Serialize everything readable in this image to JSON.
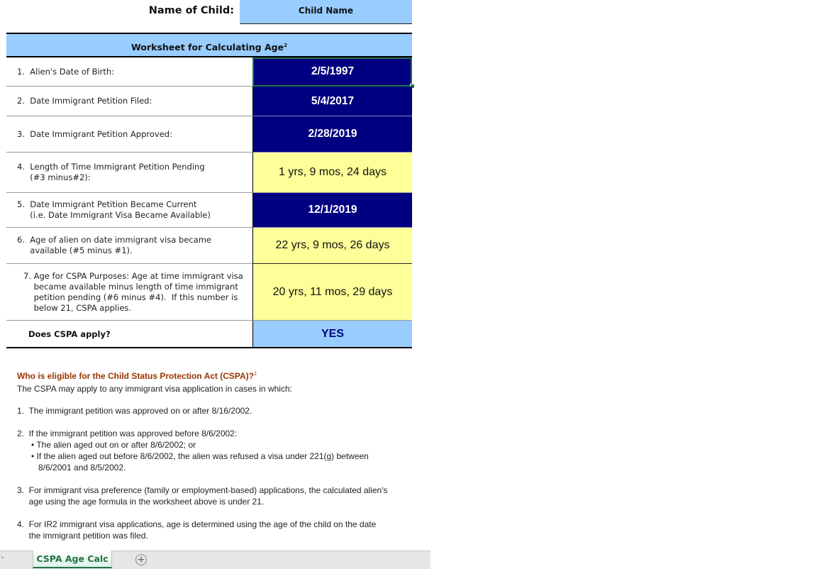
{
  "header": {
    "name_label": "Name of Child:",
    "name_value": "Child Name"
  },
  "worksheet": {
    "title": "Worksheet for Calculating Age",
    "title_footnote": "2",
    "rows": [
      {
        "label": "1.  Alien's Date of Birth:",
        "value": "2/5/1997",
        "style": "input"
      },
      {
        "label": "2.  Date Immigrant Petition Filed:",
        "value": "5/4/2017",
        "style": "input"
      },
      {
        "label": "3.  Date Immigrant Petition Approved:",
        "value": "2/28/2019",
        "style": "input"
      },
      {
        "label": "4.  Length of Time Immigrant Petition Pending\n     (#3 minus#2):",
        "value": "1 yrs, 9 mos, 24 days",
        "style": "calculated"
      },
      {
        "label": "5.  Date Immigrant Petition Became Current\n     (i.e. Date Immigrant Visa Became Available)",
        "value": "12/1/2019",
        "style": "input"
      },
      {
        "label": "6.  Age of alien on date immigrant visa became\n     available (#5 minus #1).",
        "value": "22 yrs, 9 mos, 26 days",
        "style": "calculated"
      },
      {
        "label": "7. Age for CSPA Purposes: Age at time immigrant visa\n    became available minus length of time immigrant\n    petition pending (#6 minus #4).  If this number is\n    below 21, CSPA applies.",
        "value": "20 yrs, 11 mos, 29 days",
        "style": "calculated"
      }
    ],
    "result_label": "Does CSPA apply?",
    "result_value": "YES"
  },
  "info": {
    "heading": "Who is eligible for the Child Status Protection Act (CSPA)?",
    "heading_footnote": "2",
    "intro": "The CSPA may apply to any immigrant visa application in cases in which:",
    "item1": "1.  The immigrant petition was approved on or after 8/16/2002.",
    "item2": "2.  If the immigrant petition was approved before 8/6/2002:",
    "item2_bullet1": "• The alien aged out on or after 8/6/2002; or",
    "item2_bullet2": "• If the alien aged out before 8/6/2002, the alien was refused a visa under 221(g) between\n   8/6/2001 and 8/5/2002.",
    "item3": "3.  For immigrant visa preference (family or employment-based) applications, the calculated alien's\n     age using the age formula in the worksheet above is under 21.",
    "item4": "4.  For IR2 immigrant visa applications, age is determined using the age of the child on the date\n     the immigrant petition was filed."
  },
  "tabs": {
    "nav_icon": "▸",
    "sheets": [
      "CSPA Age Calc"
    ],
    "add_icon": "+"
  },
  "colors": {
    "input_cell": "#000080",
    "calculated_cell": "#ffff99",
    "header_cell": "#99ccff",
    "heading_text": "#993300",
    "excel_green": "#217346"
  }
}
